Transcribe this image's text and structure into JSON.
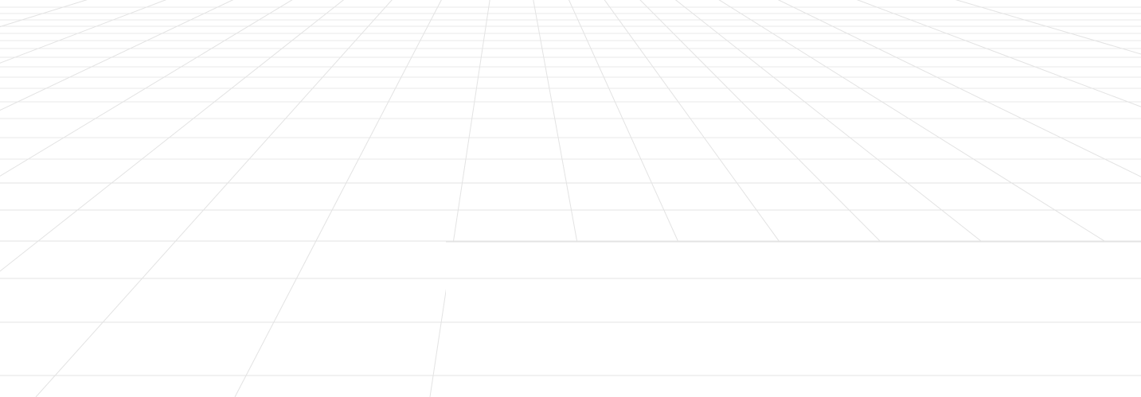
{
  "background": {
    "description": "",
    "colors": {
      "background": "#ffffff",
      "grid_line": "#e3e3e3"
    }
  }
}
